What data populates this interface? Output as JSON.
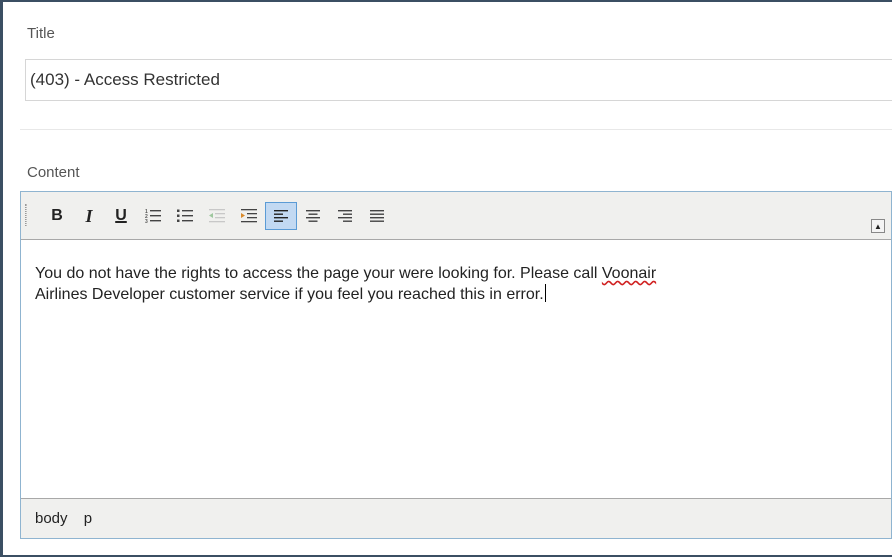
{
  "title_field": {
    "label": "Title",
    "value": "(403) - Access Restricted"
  },
  "content_field": {
    "label": "Content"
  },
  "editor": {
    "toolbar": [
      {
        "name": "bold-button",
        "glyph": "B",
        "icon": "bold-icon"
      },
      {
        "name": "italic-button",
        "glyph": "I",
        "icon": "italic-icon"
      },
      {
        "name": "underline-button",
        "glyph": "U",
        "icon": "underline-icon"
      },
      {
        "name": "numbered-list-button",
        "icon": "numbered-list-icon"
      },
      {
        "name": "bulleted-list-button",
        "icon": "bulleted-list-icon"
      },
      {
        "name": "outdent-button",
        "icon": "outdent-icon",
        "disabled": true
      },
      {
        "name": "indent-button",
        "icon": "indent-icon"
      },
      {
        "name": "align-left-button",
        "icon": "align-left-icon",
        "active": true
      },
      {
        "name": "align-center-button",
        "icon": "align-center-icon"
      },
      {
        "name": "align-right-button",
        "icon": "align-right-icon"
      },
      {
        "name": "align-justify-button",
        "icon": "align-justify-icon"
      }
    ],
    "body_text_before": "You do not have the rights to access the page your were looking for. Please call ",
    "body_text_misspelled": "Voonair",
    "body_text_after": "\nAirlines Developer customer service if you feel you reached this in error.",
    "path": [
      "body",
      "p"
    ]
  },
  "colors": {
    "frame_border": "#3b4f63",
    "editor_border": "#8fb4d0",
    "toolbar_bg": "#f0f0ee",
    "active_button_bg": "#c2d9f2",
    "spellcheck_underline": "#d02020"
  }
}
